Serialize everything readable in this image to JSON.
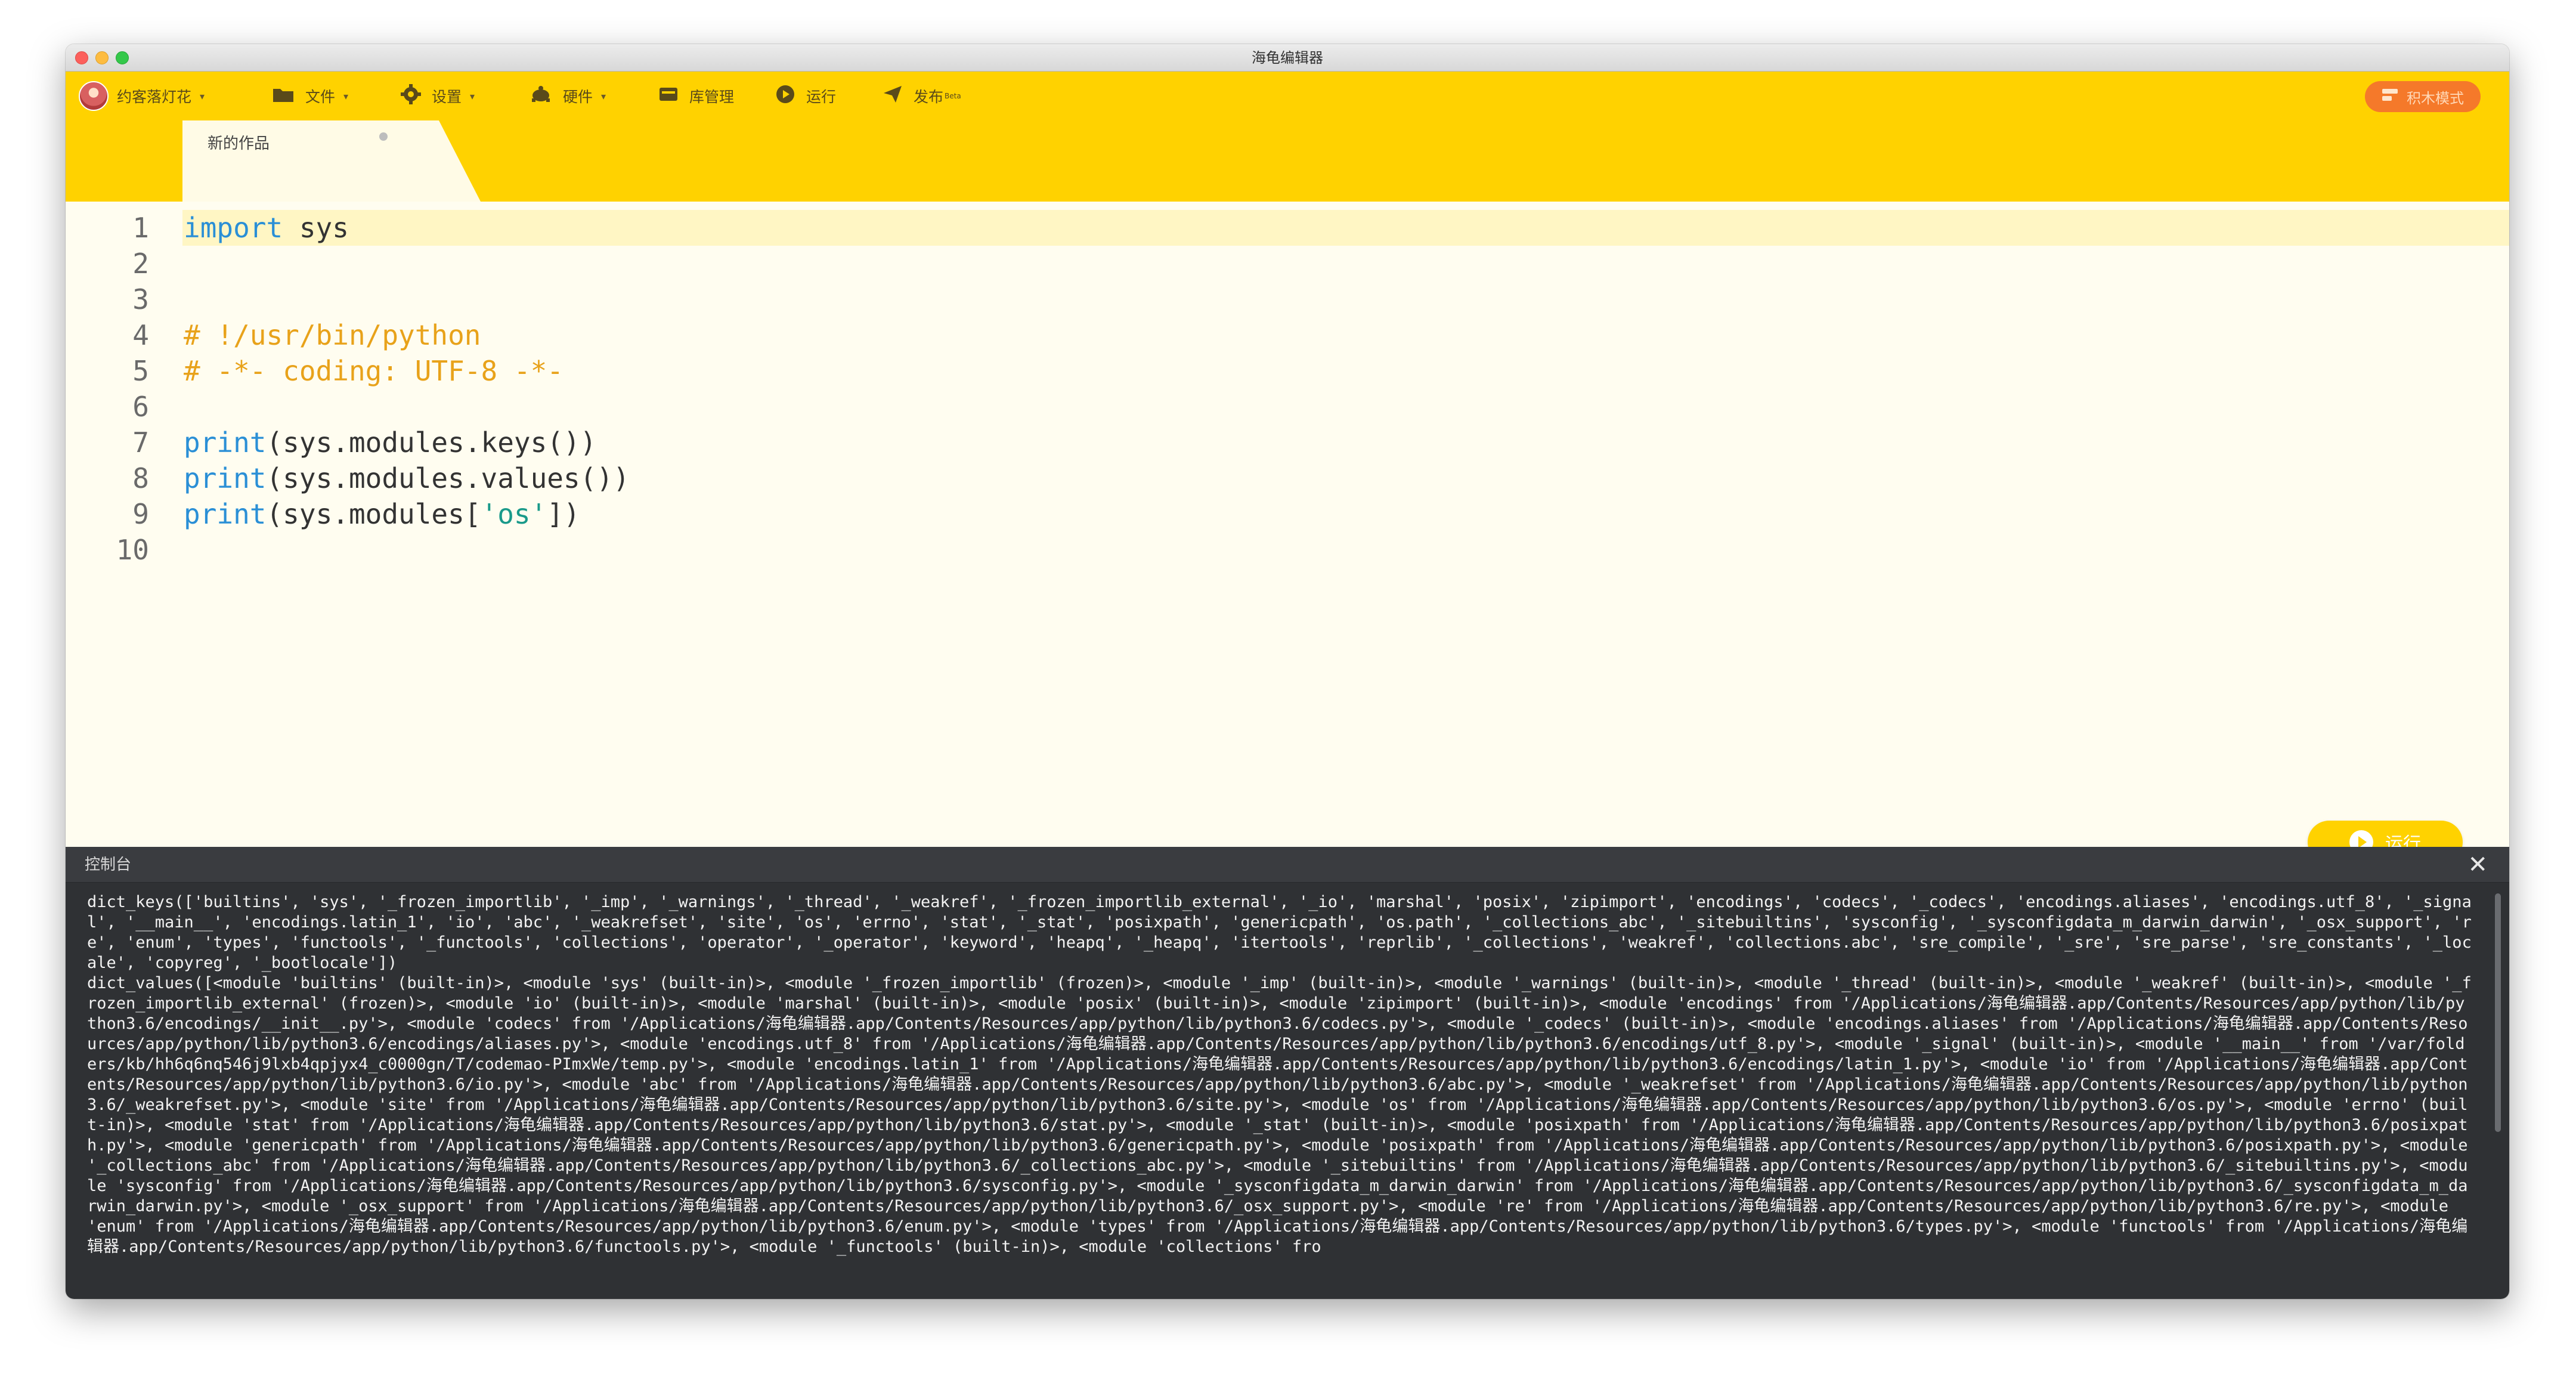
{
  "window": {
    "title": "海龟编辑器"
  },
  "toolbar": {
    "user_name": "约客落灯花",
    "file_label": "文件",
    "settings_label": "设置",
    "hardware_label": "硬件",
    "library_label": "库管理",
    "run_label": "运行",
    "publish_label": "发布",
    "publish_badge": "Beta",
    "mode_label": "积木模式"
  },
  "tab": {
    "label": "新的作品"
  },
  "editor": {
    "line_numbers": [
      "1",
      "2",
      "3",
      "4",
      "5",
      "6",
      "7",
      "8",
      "9",
      "10"
    ],
    "lines": [
      [
        {
          "t": "import",
          "c": "kw"
        },
        {
          "t": " sys",
          "c": "pn"
        }
      ],
      [],
      [],
      [
        {
          "t": "# !/usr/bin/python",
          "c": "cm"
        }
      ],
      [
        {
          "t": "# -*- coding: UTF-8 -*-",
          "c": "cm"
        }
      ],
      [],
      [
        {
          "t": "print",
          "c": "kw"
        },
        {
          "t": "(sys.modules.keys())",
          "c": "pn"
        }
      ],
      [
        {
          "t": "print",
          "c": "kw"
        },
        {
          "t": "(sys.modules.values())",
          "c": "pn"
        }
      ],
      [
        {
          "t": "print",
          "c": "kw"
        },
        {
          "t": "(sys.modules[",
          "c": "pn"
        },
        {
          "t": "'os'",
          "c": "st"
        },
        {
          "t": "])",
          "c": "pn"
        }
      ],
      []
    ],
    "active_line": 0,
    "run_button_label": "运行"
  },
  "console": {
    "title": "控制台",
    "close_glyph": "✕",
    "output": [
      "dict_keys(['builtins', 'sys', '_frozen_importlib', '_imp', '_warnings', '_thread', '_weakref', '_frozen_importlib_external', '_io', 'marshal', 'posix', 'zipimport', 'encodings', 'codecs', '_codecs', 'encodings.aliases', 'encodings.utf_8', '_signal', '__main__', 'encodings.latin_1', 'io', 'abc', '_weakrefset', 'site', 'os', 'errno', 'stat', '_stat', 'posixpath', 'genericpath', 'os.path', '_collections_abc', '_sitebuiltins', 'sysconfig', '_sysconfigdata_m_darwin_darwin', '_osx_support', 're', 'enum', 'types', 'functools', '_functools', 'collections', 'operator', '_operator', 'keyword', 'heapq', '_heapq', 'itertools', 'reprlib', '_collections', 'weakref', 'collections.abc', 'sre_compile', '_sre', 'sre_parse', 'sre_constants', '_locale', 'copyreg', '_bootlocale'])",
      "dict_values([<module 'builtins' (built-in)>, <module 'sys' (built-in)>, <module '_frozen_importlib' (frozen)>, <module '_imp' (built-in)>, <module '_warnings' (built-in)>, <module '_thread' (built-in)>, <module '_weakref' (built-in)>, <module '_frozen_importlib_external' (frozen)>, <module 'io' (built-in)>, <module 'marshal' (built-in)>, <module 'posix' (built-in)>, <module 'zipimport' (built-in)>, <module 'encodings' from '/Applications/海龟编辑器.app/Contents/Resources/app/python/lib/python3.6/encodings/__init__.py'>, <module 'codecs' from '/Applications/海龟编辑器.app/Contents/Resources/app/python/lib/python3.6/codecs.py'>, <module '_codecs' (built-in)>, <module 'encodings.aliases' from '/Applications/海龟编辑器.app/Contents/Resources/app/python/lib/python3.6/encodings/aliases.py'>, <module 'encodings.utf_8' from '/Applications/海龟编辑器.app/Contents/Resources/app/python/lib/python3.6/encodings/utf_8.py'>, <module '_signal' (built-in)>, <module '__main__' from '/var/folders/kb/hh6q6nq546j9lxb4qpjyx4_c0000gn/T/codemao-PImxWe/temp.py'>, <module 'encodings.latin_1' from '/Applications/海龟编辑器.app/Contents/Resources/app/python/lib/python3.6/encodings/latin_1.py'>, <module 'io' from '/Applications/海龟编辑器.app/Contents/Resources/app/python/lib/python3.6/io.py'>, <module 'abc' from '/Applications/海龟编辑器.app/Contents/Resources/app/python/lib/python3.6/abc.py'>, <module '_weakrefset' from '/Applications/海龟编辑器.app/Contents/Resources/app/python/lib/python3.6/_weakrefset.py'>, <module 'site' from '/Applications/海龟编辑器.app/Contents/Resources/app/python/lib/python3.6/site.py'>, <module 'os' from '/Applications/海龟编辑器.app/Contents/Resources/app/python/lib/python3.6/os.py'>, <module 'errno' (built-in)>, <module 'stat' from '/Applications/海龟编辑器.app/Contents/Resources/app/python/lib/python3.6/stat.py'>, <module '_stat' (built-in)>, <module 'posixpath' from '/Applications/海龟编辑器.app/Contents/Resources/app/python/lib/python3.6/posixpath.py'>, <module 'genericpath' from '/Applications/海龟编辑器.app/Contents/Resources/app/python/lib/python3.6/genericpath.py'>, <module 'posixpath' from '/Applications/海龟编辑器.app/Contents/Resources/app/python/lib/python3.6/posixpath.py'>, <module '_collections_abc' from '/Applications/海龟编辑器.app/Contents/Resources/app/python/lib/python3.6/_collections_abc.py'>, <module '_sitebuiltins' from '/Applications/海龟编辑器.app/Contents/Resources/app/python/lib/python3.6/_sitebuiltins.py'>, <module 'sysconfig' from '/Applications/海龟编辑器.app/Contents/Resources/app/python/lib/python3.6/sysconfig.py'>, <module '_sysconfigdata_m_darwin_darwin' from '/Applications/海龟编辑器.app/Contents/Resources/app/python/lib/python3.6/_sysconfigdata_m_darwin_darwin.py'>, <module '_osx_support' from '/Applications/海龟编辑器.app/Contents/Resources/app/python/lib/python3.6/_osx_support.py'>, <module 're' from '/Applications/海龟编辑器.app/Contents/Resources/app/python/lib/python3.6/re.py'>, <module 'enum' from '/Applications/海龟编辑器.app/Contents/Resources/app/python/lib/python3.6/enum.py'>, <module 'types' from '/Applications/海龟编辑器.app/Contents/Resources/app/python/lib/python3.6/types.py'>, <module 'functools' from '/Applications/海龟编辑器.app/Contents/Resources/app/python/lib/python3.6/functools.py'>, <module '_functools' (built-in)>, <module 'collections' fro"
    ]
  },
  "colors": {
    "toolbar_bg": "#ffd200",
    "editor_bg": "#fffdf0",
    "keyword": "#2a8fd6",
    "comment": "#e8a21a",
    "string": "#1a9a8a",
    "console_bg": "#2f3134",
    "mode_button": "#f5792a"
  },
  "icons": {
    "file": "folder-icon",
    "settings": "gear-icon",
    "hardware": "turtle-icon",
    "library": "package-icon",
    "run": "play-icon",
    "publish": "paper-plane-icon",
    "mode": "blocks-icon"
  }
}
